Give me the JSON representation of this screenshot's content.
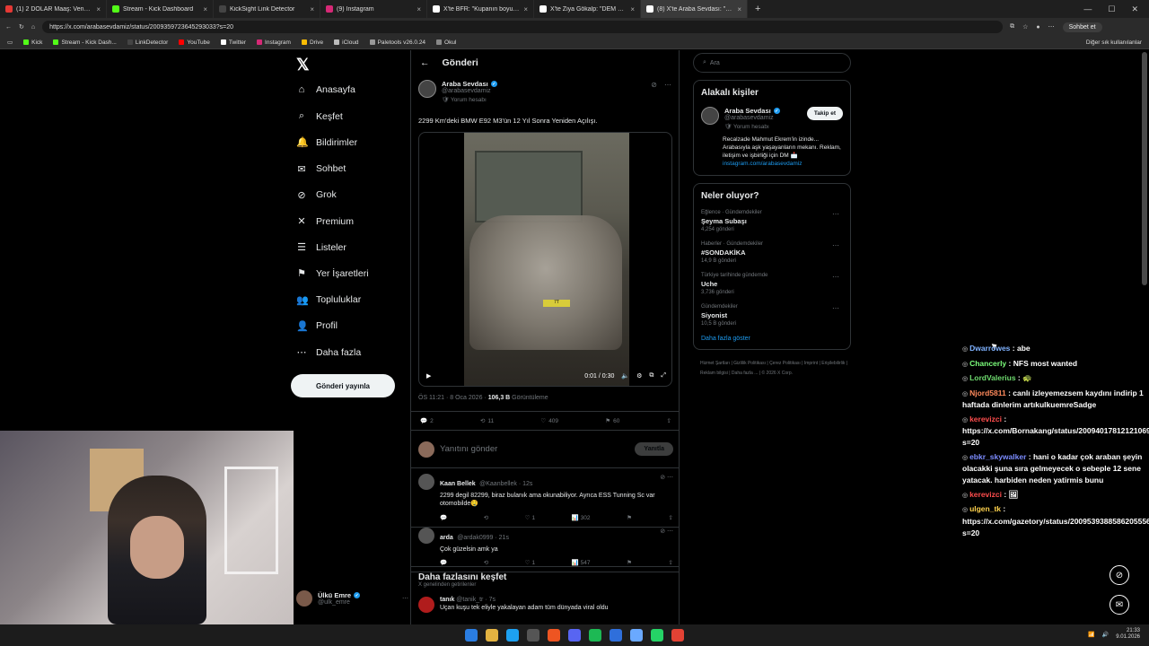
{
  "browser": {
    "tabs": [
      {
        "label": "(1) 2 DOLAR Maaş: Venezuela'da I",
        "color": "#e53935"
      },
      {
        "label": "Stream - Kick Dashboard",
        "color": "#53fc18"
      },
      {
        "label": "KickSight Link Detector",
        "color": "#444"
      },
      {
        "label": "(9) Instagram",
        "color": "#d62976"
      },
      {
        "label": "X'te BFR: \"Kupanın boyunu gören",
        "color": "#fff"
      },
      {
        "label": "X'te Ziya Gökalp: \"DEM partiyi mı",
        "color": "#fff"
      },
      {
        "label": "(8) X'te Araba Sevdası: \"2299 Km'",
        "color": "#fff"
      }
    ],
    "new_tab": "+",
    "url": "https://x.com/arabasevdamiz/status/2009359723645293033?s=20",
    "chat_label": "Sohbet et",
    "bookmarks": [
      {
        "label": "Kick",
        "color": "#53fc18"
      },
      {
        "label": "Stream - Kick Dash...",
        "color": "#53fc18"
      },
      {
        "label": "LinkDetector",
        "color": "#444"
      },
      {
        "label": "YouTube",
        "color": "#ff0000"
      },
      {
        "label": "Twitter",
        "color": "#fff"
      },
      {
        "label": "Instagram",
        "color": "#d62976"
      },
      {
        "label": "Drive",
        "color": "#fbbc04"
      },
      {
        "label": "iCloud",
        "color": "#bbb"
      },
      {
        "label": "Paletools v26.0.24",
        "color": "#999"
      },
      {
        "label": "Okul",
        "color": "#888"
      }
    ],
    "other_bookmarks": "Diğer sık kullanılanlar"
  },
  "nav": {
    "items": [
      {
        "label": "Anasayfa",
        "icon": "⌂"
      },
      {
        "label": "Keşfet",
        "icon": "⌕"
      },
      {
        "label": "Bildirimler",
        "icon": "🔔"
      },
      {
        "label": "Sohbet",
        "icon": "✉"
      },
      {
        "label": "Grok",
        "icon": "⊘"
      },
      {
        "label": "Premium",
        "icon": "✕"
      },
      {
        "label": "Listeler",
        "icon": "☰"
      },
      {
        "label": "Yer İşaretleri",
        "icon": "⚑"
      },
      {
        "label": "Topluluklar",
        "icon": "👥"
      },
      {
        "label": "Profil",
        "icon": "👤"
      },
      {
        "label": "Daha fazla",
        "icon": "⋯"
      }
    ],
    "post_button": "Gönderi yayınla",
    "account": {
      "name": "Ülkü Emre",
      "handle": "@ulk_emre"
    }
  },
  "post": {
    "header": "Gönderi",
    "author": "Araba Sevdası",
    "handle": "@arabasevdamiz",
    "tag": "Yorum hesabı",
    "text": "2299 Km'deki BMW E92 M3'ün 12 Yıl Sonra Yeniden Açılışı.",
    "video_time": "0:01 / 0:30",
    "plate": "7T",
    "meta_time": "ÖS 11:21 · 8 Oca 2026 · ",
    "meta_views": "106,3 B",
    "meta_views_label": " Görüntüleme",
    "stats": {
      "replies": "2",
      "reposts": "11",
      "likes": "409",
      "bookmarks": "60"
    },
    "reply_placeholder": "Yanıtını gönder",
    "reply_button": "Yanıtla"
  },
  "replies": [
    {
      "name": "Kaan Bellek",
      "handle": "@Kaanbellek · 12s",
      "text": "2299 degil 82299, biraz bulanık ama okunabiliyor. Ayrıca ESS Tunning Sc var otomobilde🤤",
      "likes": "1",
      "views": "302"
    },
    {
      "name": "arda",
      "handle": "@ardak0999 · 21s",
      "text": "Çok güzelsin amk ya",
      "likes": "1",
      "views": "547"
    }
  ],
  "explore": {
    "title": "Daha fazlasını keşfet",
    "sub": "X genelinden getirilenler",
    "item": {
      "name": "tanık",
      "handle": "@tanik_tr · 7s",
      "text": "Uçan kuşu tek eliyle yakalayan adam tüm dünyada viral oldu"
    }
  },
  "sidebar": {
    "search_placeholder": "Ara",
    "related_title": "Alakalı kişiler",
    "person": {
      "name": "Araba Sevdası",
      "handle": "@arabasevdamiz",
      "tag": "Yorum hesabı",
      "follow": "Takip et",
      "bio": "Recalzade Mahmut Ekrem'in izinde... Arabasıyla aşk yaşayanların mekanı. Reklam, iletişim ve işbirliği için DM 📩",
      "link": "instagram.com/arabasevdamiz"
    },
    "trends_title": "Neler oluyor?",
    "trends": [
      {
        "cat": "Eğlence · Gündemdekiler",
        "title": "Şeyma Subaşı",
        "count": "4,254 gönderi"
      },
      {
        "cat": "Haberler · Gündemdekiler",
        "title": "#SONDAKİKA",
        "count": "14,9 B gönderi"
      },
      {
        "cat": "Türkiye tarihinde gündemde",
        "title": "Uche",
        "count": "3,736 gönderi"
      },
      {
        "cat": "Gündemdekiler",
        "title": "Siyonist",
        "count": "10,5 B gönderi"
      }
    ],
    "show_more": "Daha fazla göster",
    "footer": [
      "Hizmet Şartları",
      "Gizlilik Politikası",
      "Çerez Politikası",
      "Imprint",
      "Erişilebilirlik",
      "Reklam bilgisi",
      "Daha fazla ...",
      "© 2026 X Corp."
    ]
  },
  "chat": [
    {
      "user": "Dwarrowes",
      "msg": "abe",
      "cls": "u1"
    },
    {
      "user": "Chancerly",
      "msg": "NFS most wanted",
      "cls": "u2"
    },
    {
      "user": "LordValerius",
      "msg": "🐢",
      "cls": "u3"
    },
    {
      "user": "Njord5811",
      "msg": "canlı izleyemezsem kaydını indirip 1 haftada dinlerim artıkulkuemreSadge",
      "cls": "u4"
    },
    {
      "user": "kerevizci",
      "msg": "https://x.com/Bornakang/status/2009401781212106960?s=20",
      "cls": "u5"
    },
    {
      "user": "ebkr_skywalker",
      "msg": "hani o kadar çok araban şeyin olacakki şuna sıra gelmeyecek o sebeple 12 sene yatacak. harbiden neden yatirmis bunu",
      "cls": "u6"
    },
    {
      "user": "kerevizci",
      "msg": "🖼",
      "cls": "u5"
    },
    {
      "user": "ulgen_tk",
      "msg": "https://x.com/gazetory/status/2009539388586205556?s=20",
      "cls": "u7"
    }
  ],
  "taskbar": {
    "time": "21:33",
    "date": "9.01.2026"
  }
}
